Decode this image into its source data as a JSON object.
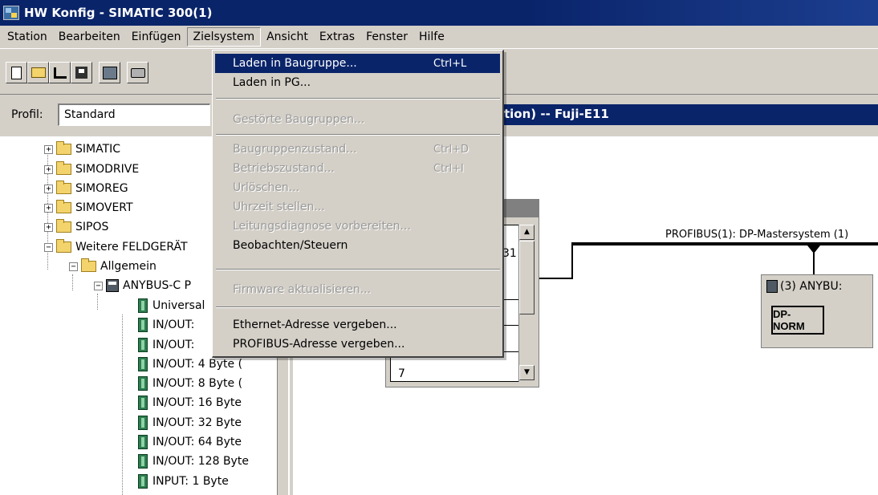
{
  "window": {
    "title": "HW Konfig - SIMATIC 300(1)"
  },
  "menubar": {
    "items": [
      "Station",
      "Bearbeiten",
      "Einfügen",
      "Zielsystem",
      "Ansicht",
      "Extras",
      "Fenster",
      "Hilfe"
    ],
    "open_item": "Zielsystem"
  },
  "toolbar": {
    "icons": [
      "new-icon",
      "open-icon",
      "network-icon",
      "save-icon",
      "hardware-icon",
      "print-icon"
    ]
  },
  "profile": {
    "label": "Profil:",
    "value": "Standard"
  },
  "station_title": "tion) -- Fuji-E11",
  "dropdown": {
    "items": [
      {
        "label": "Laden in Baugruppe...",
        "shortcut": "Ctrl+L",
        "enabled": true,
        "highlighted": true
      },
      {
        "label": "Laden in PG...",
        "shortcut": "",
        "enabled": true
      },
      {
        "label": "Gestörte Baugruppen...",
        "shortcut": "",
        "enabled": false
      },
      {
        "label": "Baugruppenzustand...",
        "shortcut": "Ctrl+D",
        "enabled": false
      },
      {
        "label": "Betriebszustand...",
        "shortcut": "Ctrl+I",
        "enabled": false
      },
      {
        "label": "Urlöschen...",
        "shortcut": "",
        "enabled": false
      },
      {
        "label": "Uhrzeit stellen...",
        "shortcut": "",
        "enabled": false
      },
      {
        "label": "Leitungsdiagnose vorbereiten...",
        "shortcut": "",
        "enabled": false
      },
      {
        "label": "Beobachten/Steuern",
        "shortcut": "",
        "enabled": true
      },
      {
        "label": "Firmware aktualisieren...",
        "shortcut": "",
        "enabled": false
      },
      {
        "label": "Ethernet-Adresse vergeben...",
        "shortcut": "",
        "enabled": true
      },
      {
        "label": "PROFIBUS-Adresse vergeben...",
        "shortcut": "",
        "enabled": true
      }
    ]
  },
  "tree": {
    "folders": [
      "SIMATIC",
      "SIMODRIVE",
      "SIMOREG",
      "SIMOVERT",
      "SIPOS",
      "Weitere FELDGERÄT"
    ],
    "subfolder": "Allgemein",
    "device": "ANYBUS-C P",
    "modules": [
      "Universal",
      "IN/OUT:",
      "IN/OUT:",
      "IN/OUT:  4 Byte (",
      "IN/OUT:  8 Byte (",
      "IN/OUT:  16 Byte",
      "IN/OUT:  32 Byte",
      "IN/OUT:  64 Byte",
      "IN/OUT: 128 Byte",
      "INPUT:   1 Byte"
    ]
  },
  "rack": {
    "visible_text": [
      "31",
      "7"
    ]
  },
  "profibus": {
    "label": "PROFIBUS(1): DP-Mastersystem (1)",
    "slave_title": "(3) ANYBU:",
    "slave_badge": "DP-NORM"
  }
}
